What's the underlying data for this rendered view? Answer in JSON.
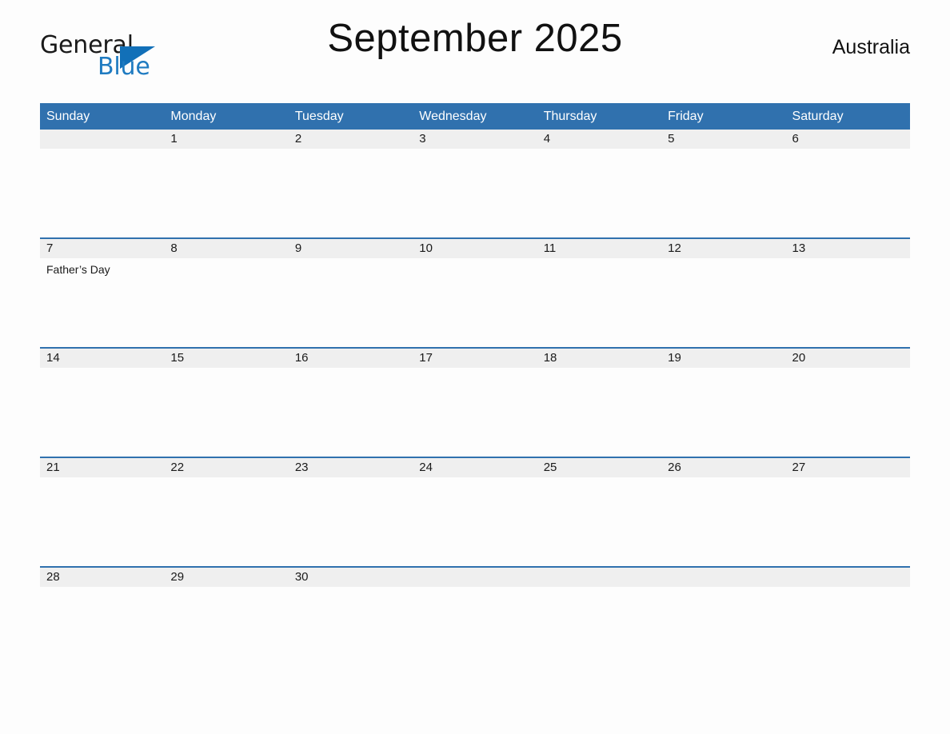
{
  "brand": {
    "logo_word_one": "General",
    "logo_word_two": "Blue",
    "logo_icon": "triangle-icon",
    "colors": {
      "logo_blue": "#1f7bc1",
      "triangle_blue": "#1270b8"
    }
  },
  "header": {
    "title": "September 2025",
    "country": "Australia"
  },
  "colors": {
    "header_blue": "#3071ae",
    "date_band_gray": "#efefef",
    "page_background": "#fdfdfd",
    "text": "#1a1a1a"
  },
  "calendar": {
    "month": "September",
    "year": "2025",
    "weekdays": [
      "Sunday",
      "Monday",
      "Tuesday",
      "Wednesday",
      "Thursday",
      "Friday",
      "Saturday"
    ],
    "weeks": [
      {
        "days": [
          {
            "date": "",
            "event": ""
          },
          {
            "date": "1",
            "event": ""
          },
          {
            "date": "2",
            "event": ""
          },
          {
            "date": "3",
            "event": ""
          },
          {
            "date": "4",
            "event": ""
          },
          {
            "date": "5",
            "event": ""
          },
          {
            "date": "6",
            "event": ""
          }
        ]
      },
      {
        "days": [
          {
            "date": "7",
            "event": "Father’s Day"
          },
          {
            "date": "8",
            "event": ""
          },
          {
            "date": "9",
            "event": ""
          },
          {
            "date": "10",
            "event": ""
          },
          {
            "date": "11",
            "event": ""
          },
          {
            "date": "12",
            "event": ""
          },
          {
            "date": "13",
            "event": ""
          }
        ]
      },
      {
        "days": [
          {
            "date": "14",
            "event": ""
          },
          {
            "date": "15",
            "event": ""
          },
          {
            "date": "16",
            "event": ""
          },
          {
            "date": "17",
            "event": ""
          },
          {
            "date": "18",
            "event": ""
          },
          {
            "date": "19",
            "event": ""
          },
          {
            "date": "20",
            "event": ""
          }
        ]
      },
      {
        "days": [
          {
            "date": "21",
            "event": ""
          },
          {
            "date": "22",
            "event": ""
          },
          {
            "date": "23",
            "event": ""
          },
          {
            "date": "24",
            "event": ""
          },
          {
            "date": "25",
            "event": ""
          },
          {
            "date": "26",
            "event": ""
          },
          {
            "date": "27",
            "event": ""
          }
        ]
      },
      {
        "days": [
          {
            "date": "28",
            "event": ""
          },
          {
            "date": "29",
            "event": ""
          },
          {
            "date": "30",
            "event": ""
          },
          {
            "date": "",
            "event": ""
          },
          {
            "date": "",
            "event": ""
          },
          {
            "date": "",
            "event": ""
          },
          {
            "date": "",
            "event": ""
          }
        ]
      }
    ]
  }
}
